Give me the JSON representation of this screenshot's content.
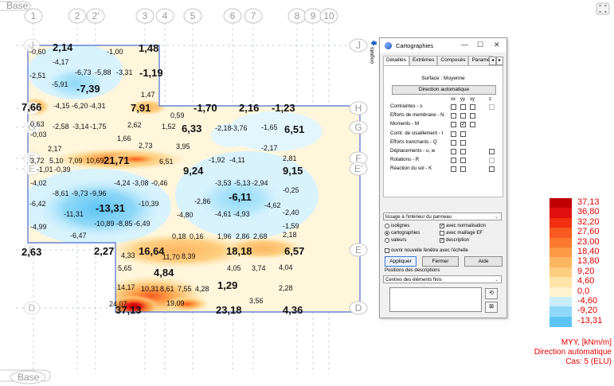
{
  "canvas": {
    "base_top": "Base",
    "base_bottom": "Base",
    "axes_top": [
      "1",
      "2",
      "2'",
      "3",
      "4",
      "5",
      "6",
      "7",
      "8",
      "9",
      "10"
    ],
    "axes_right": [
      "J",
      "H",
      "G",
      "F",
      "E'",
      "E",
      "D"
    ],
    "axes_left": [
      "J",
      "H",
      "G",
      "F",
      "E",
      "E",
      "D"
    ],
    "values": [
      {
        "t": "-0,60",
        "s": "s"
      },
      {
        "t": "2,14",
        "s": "l"
      },
      {
        "t": "-1,00",
        "s": "s"
      },
      {
        "t": "1,48",
        "s": "l"
      },
      {
        "t": "-4,17",
        "s": "s"
      },
      {
        "t": "-2,51",
        "s": "s"
      },
      {
        "t": "-6,73",
        "s": "s"
      },
      {
        "t": "-5,88",
        "s": "s"
      },
      {
        "t": "-3,31",
        "s": "s"
      },
      {
        "t": "-1,19",
        "s": "l"
      },
      {
        "t": "-5,91",
        "s": "s"
      },
      {
        "t": "-7,39",
        "s": "l"
      },
      {
        "t": "1,47",
        "s": "s"
      },
      {
        "t": "7,66",
        "s": "l"
      },
      {
        "t": "-4,15",
        "s": "s"
      },
      {
        "t": "-6,20",
        "s": "s"
      },
      {
        "t": "-4,31",
        "s": "s"
      },
      {
        "t": "7,91",
        "s": "l"
      },
      {
        "t": "-1,70",
        "s": "l"
      },
      {
        "t": "2,16",
        "s": "l"
      },
      {
        "t": "-1,23",
        "s": "l"
      },
      {
        "t": "0,59",
        "s": "s"
      },
      {
        "t": "0,63",
        "s": "s"
      },
      {
        "t": "-2,58",
        "s": "s"
      },
      {
        "t": "-3,14",
        "s": "s"
      },
      {
        "t": "-1,75",
        "s": "s"
      },
      {
        "t": "2,62",
        "s": "s"
      },
      {
        "t": "1,52",
        "s": "s"
      },
      {
        "t": "6,33",
        "s": "l"
      },
      {
        "t": "-2,18",
        "s": "s"
      },
      {
        "t": "-3,76",
        "s": "s"
      },
      {
        "t": "-1,65",
        "s": "s"
      },
      {
        "t": "6,51",
        "s": "l"
      },
      {
        "t": "-0,03",
        "s": "s"
      },
      {
        "t": "1,66",
        "s": "s"
      },
      {
        "t": "2,73",
        "s": "s"
      },
      {
        "t": "3,95",
        "s": "s"
      },
      {
        "t": "-2,17",
        "s": "s"
      },
      {
        "t": "2,17",
        "s": "s"
      },
      {
        "t": "3,72",
        "s": "s"
      },
      {
        "t": "5,10",
        "s": "s"
      },
      {
        "t": "7,09",
        "s": "s"
      },
      {
        "t": "10,69",
        "s": "s"
      },
      {
        "t": "21,71",
        "s": "l"
      },
      {
        "t": "6,51",
        "s": "s"
      },
      {
        "t": "-1,92",
        "s": "s"
      },
      {
        "t": "-4,11",
        "s": "s"
      },
      {
        "t": "2,81",
        "s": "s"
      },
      {
        "t": "-1,01",
        "s": "s"
      },
      {
        "t": "-0,39",
        "s": "s"
      },
      {
        "t": "9,24",
        "s": "l"
      },
      {
        "t": "9,15",
        "s": "l"
      },
      {
        "t": "-4,02",
        "s": "s"
      },
      {
        "t": "-4,24",
        "s": "s"
      },
      {
        "t": "-3,08",
        "s": "s"
      },
      {
        "t": "-0,46",
        "s": "s"
      },
      {
        "t": "-3,53",
        "s": "s"
      },
      {
        "t": "-5,13",
        "s": "s"
      },
      {
        "t": "-2,94",
        "s": "s"
      },
      {
        "t": "-0,25",
        "s": "s"
      },
      {
        "t": "-8,61",
        "s": "s"
      },
      {
        "t": "-9,73",
        "s": "s"
      },
      {
        "t": "-9,96",
        "s": "s"
      },
      {
        "t": "-6,11",
        "s": "l"
      },
      {
        "t": "-2,86",
        "s": "s"
      },
      {
        "t": "-6,42",
        "s": "s"
      },
      {
        "t": "-10,39",
        "s": "s"
      },
      {
        "t": "-4,62",
        "s": "s"
      },
      {
        "t": "-11,31",
        "s": "s"
      },
      {
        "t": "-13,31",
        "s": "l"
      },
      {
        "t": "-4,80",
        "s": "s"
      },
      {
        "t": "-4,61",
        "s": "s"
      },
      {
        "t": "-4,93",
        "s": "s"
      },
      {
        "t": "-2,40",
        "s": "s"
      },
      {
        "t": "-4,99",
        "s": "s"
      },
      {
        "t": "-10,89",
        "s": "s"
      },
      {
        "t": "-8,85",
        "s": "s"
      },
      {
        "t": "-6,49",
        "s": "s"
      },
      {
        "t": "-1,59",
        "s": "s"
      },
      {
        "t": "-6,47",
        "s": "s"
      },
      {
        "t": "0,18",
        "s": "s"
      },
      {
        "t": "0,16",
        "s": "s"
      },
      {
        "t": "1,96",
        "s": "s"
      },
      {
        "t": "2,86",
        "s": "s"
      },
      {
        "t": "2,68",
        "s": "s"
      },
      {
        "t": "2,18",
        "s": "s"
      },
      {
        "t": "2,63",
        "s": "l"
      },
      {
        "t": "2,27",
        "s": "l"
      },
      {
        "t": "4,33",
        "s": "s"
      },
      {
        "t": "16,64",
        "s": "l"
      },
      {
        "t": "11,70",
        "s": "s"
      },
      {
        "t": "8,39",
        "s": "s"
      },
      {
        "t": "18,18",
        "s": "l"
      },
      {
        "t": "6,57",
        "s": "l"
      },
      {
        "t": "5,65",
        "s": "s"
      },
      {
        "t": "4,84",
        "s": "l"
      },
      {
        "t": "4,05",
        "s": "s"
      },
      {
        "t": "3,74",
        "s": "s"
      },
      {
        "t": "4,04",
        "s": "s"
      },
      {
        "t": "14,17",
        "s": "s"
      },
      {
        "t": "10,31",
        "s": "s"
      },
      {
        "t": "8,61",
        "s": "s"
      },
      {
        "t": "7,55",
        "s": "s"
      },
      {
        "t": "4,28",
        "s": "s"
      },
      {
        "t": "1,29",
        "s": "l"
      },
      {
        "t": "2,28",
        "s": "s"
      },
      {
        "t": "24,07",
        "s": "s"
      },
      {
        "t": "19,09",
        "s": "s"
      },
      {
        "t": "3,56",
        "s": "s"
      },
      {
        "t": "37,13",
        "s": "l"
      },
      {
        "t": "23,18",
        "s": "l"
      },
      {
        "t": "4,36",
        "s": "l"
      }
    ]
  },
  "onglets_label": "onglets",
  "dialog": {
    "title": "Cartographies",
    "minimize": "—",
    "maximize": "☐",
    "close": "✕",
    "tabs": [
      "Détaillés",
      "Extrêmes",
      "Composés",
      "Paramè"
    ],
    "surface": "Surface : Moyenne",
    "direction_button": "Direction automatique",
    "col_headers": [
      "xx",
      "yy",
      "xy",
      "z"
    ],
    "rows": [
      {
        "label": "Contraintes - s",
        "checks": [
          false,
          false,
          false
        ],
        "z": "dis"
      },
      {
        "label": "Efforts de membrane - N",
        "checks": [
          false,
          false,
          false
        ],
        "z": "none"
      },
      {
        "label": "Moments - M",
        "checks": [
          false,
          true,
          false
        ],
        "z": "none"
      },
      {
        "label": "Contr. de cisaillement - t",
        "checks": [
          false,
          false
        ],
        "z": "none"
      },
      {
        "label": "Efforts tranchants - Q",
        "checks": [
          false,
          false
        ],
        "z": "none"
      },
      {
        "label": "Déplacements - u, w",
        "checks": [
          false,
          false
        ],
        "z": "box"
      },
      {
        "label": "Rotations - R",
        "checks": [
          false,
          false
        ],
        "z": "dis"
      },
      {
        "label": "Réaction du sol - K",
        "checks": [],
        "z": "box"
      }
    ],
    "smoothing_select": "lissage à l'intérieur du panneau",
    "options_left": [
      {
        "label": "isolignes",
        "selected": false
      },
      {
        "label": "cartographies",
        "selected": true
      },
      {
        "label": "valeurs",
        "selected": false
      }
    ],
    "options_right": [
      {
        "label": "avec normalisation",
        "checked": true
      },
      {
        "label": "avec maillage EF",
        "checked": false
      },
      {
        "label": "description",
        "checked": true
      }
    ],
    "new_window_option": "ouvrir nouvelle fenêtre avec l'échelle",
    "apply_button": "Appliquer",
    "close_button": "Fermer",
    "help_button": "Aide",
    "positions_label": "Positions des descriptions",
    "positions_select": "Centres des éléments finis"
  },
  "legend": {
    "entries": [
      {
        "label": "37,13",
        "color": "#c00000"
      },
      {
        "label": "36,80",
        "color": "#e01010"
      },
      {
        "label": "32,20",
        "color": "#f03010"
      },
      {
        "label": "27,60",
        "color": "#f85a20"
      },
      {
        "label": "23,00",
        "color": "#fb7a30"
      },
      {
        "label": "18,40",
        "color": "#fc9a45"
      },
      {
        "label": "13,80",
        "color": "#fdb660"
      },
      {
        "label": "9,20",
        "color": "#fece80"
      },
      {
        "label": "4,60",
        "color": "#ffe4a8"
      },
      {
        "label": "0,0",
        "color": "#fff3d0"
      },
      {
        "label": "-4,60",
        "color": "#c9eefc"
      },
      {
        "label": "-9,20",
        "color": "#8fd8f8"
      },
      {
        "label": "-13,31",
        "color": "#5ec4f4"
      }
    ],
    "quantity": "MYY, [kNm/m]",
    "direction": "Direction automatique",
    "case": "Cas: 5 (ELU)"
  }
}
